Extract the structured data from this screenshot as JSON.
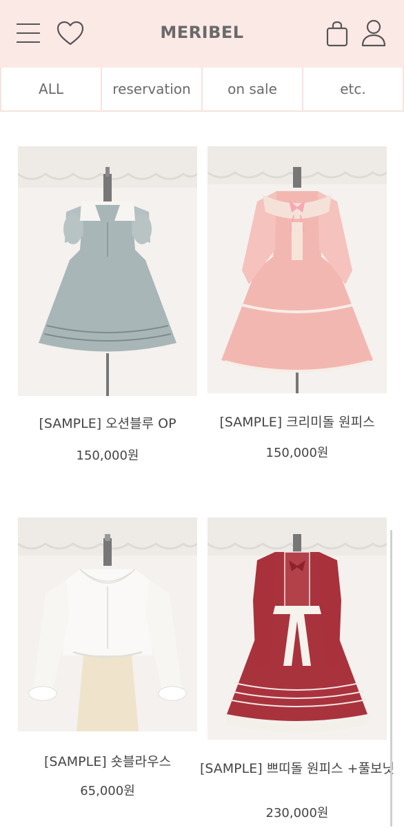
{
  "header": {
    "logo": "MERIBEL",
    "icons": [
      "menu-icon",
      "heart-icon",
      "shopping-bag-icon",
      "user-icon"
    ]
  },
  "tabs": [
    {
      "label": "ALL"
    },
    {
      "label": "reservation"
    },
    {
      "label": "on sale"
    },
    {
      "label": "etc."
    }
  ],
  "products": [
    {
      "name": "[SAMPLE] 오션블루 OP",
      "price": "150,000원"
    },
    {
      "name": "[SAMPLE] 크리미돌 원피스",
      "price": "150,000원"
    },
    {
      "name": "[SAMPLE] 숏블라우스",
      "price": "65,000원"
    },
    {
      "name": "[SAMPLE] 쁘띠돌 원피스 +풀보닛",
      "price": "230,000원"
    }
  ],
  "colors": {
    "header_bg": "#fbe9e5",
    "text": "#444444"
  }
}
